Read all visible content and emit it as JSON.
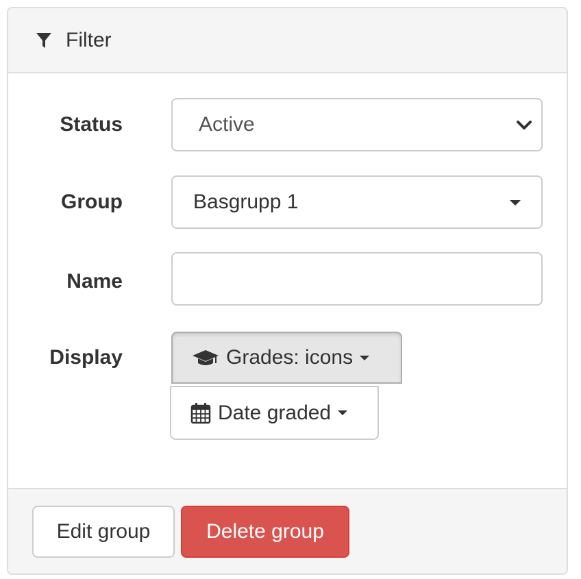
{
  "panel": {
    "title": "Filter",
    "icon": "filter-icon"
  },
  "form": {
    "status": {
      "label": "Status",
      "value": "Active"
    },
    "group": {
      "label": "Group",
      "value": "Basgrupp 1"
    },
    "name": {
      "label": "Name",
      "value": "",
      "placeholder": ""
    },
    "display": {
      "label": "Display",
      "grades_button": {
        "label": "Grades: icons",
        "icon": "graduation-cap-icon"
      },
      "date_button": {
        "label": "Date graded",
        "icon": "calendar-icon"
      }
    }
  },
  "footer": {
    "edit_label": "Edit group",
    "delete_label": "Delete group"
  },
  "colors": {
    "danger": "#d9534f",
    "panel_bg": "#f5f5f5",
    "border": "#dddddd"
  }
}
